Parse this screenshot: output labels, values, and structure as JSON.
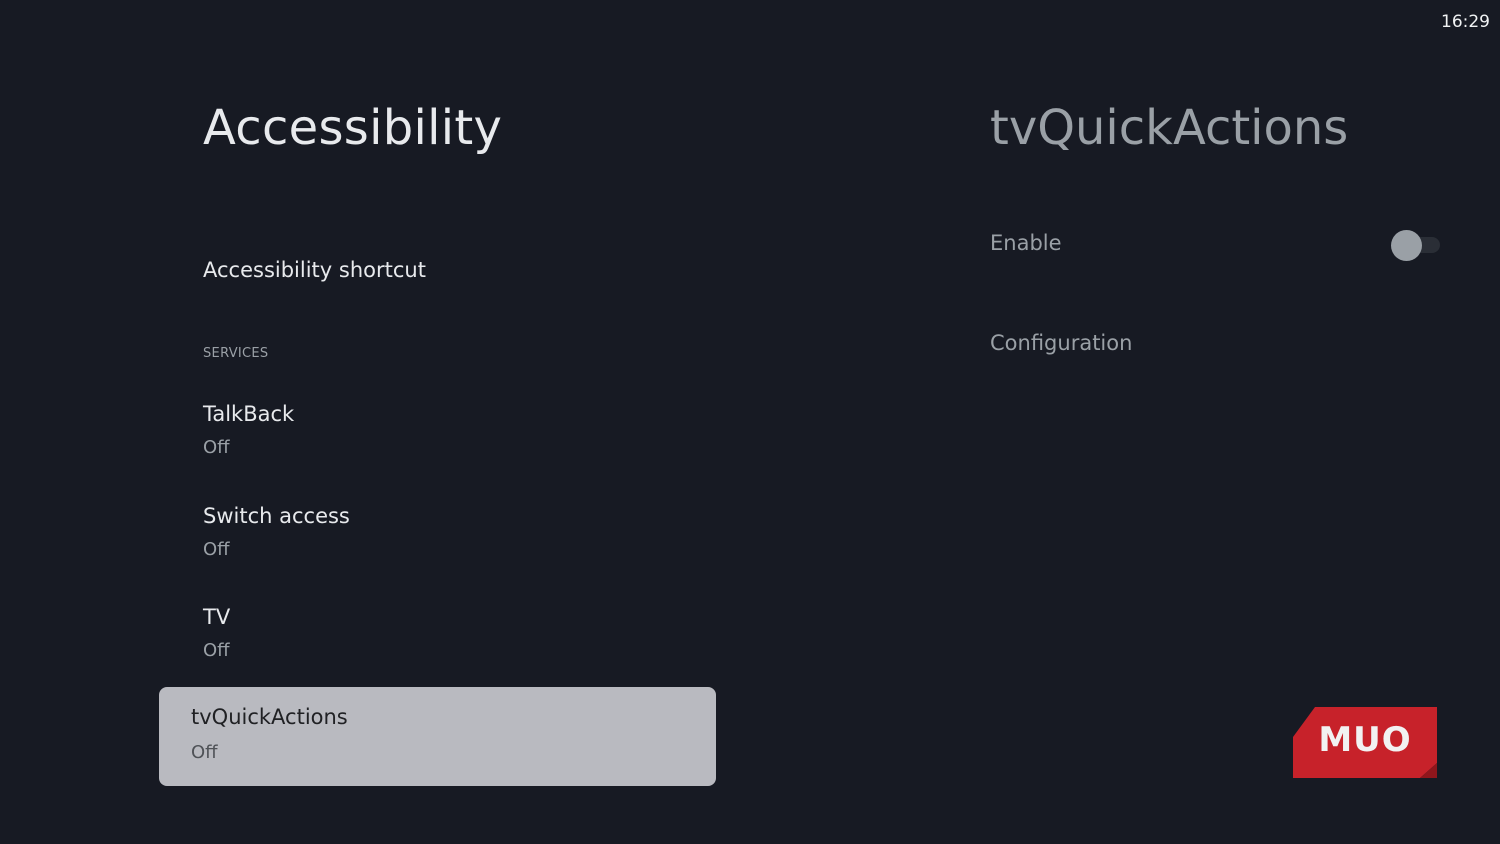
{
  "status_bar": {
    "time": "16:29"
  },
  "left_panel": {
    "title": "Accessibility",
    "shortcut": {
      "label": "Accessibility shortcut"
    },
    "services_header": "SERVICES",
    "items": [
      {
        "label": "TalkBack",
        "status": "Off"
      },
      {
        "label": "Switch access",
        "status": "Off"
      },
      {
        "label": "TV",
        "status": "Off"
      },
      {
        "label": "tvQuickActions",
        "status": "Off",
        "focused": true
      }
    ]
  },
  "right_panel": {
    "title": "tvQuickActions",
    "enable_label": "Enable",
    "enable_state": false,
    "configuration_label": "Configuration"
  },
  "watermark": {
    "text": "MUO",
    "color": "#c7222a"
  },
  "colors": {
    "background": "#171a23",
    "focused_card": "#b9bac0",
    "primary_text": "#e8eaed",
    "secondary_text": "#9aa0a6"
  }
}
